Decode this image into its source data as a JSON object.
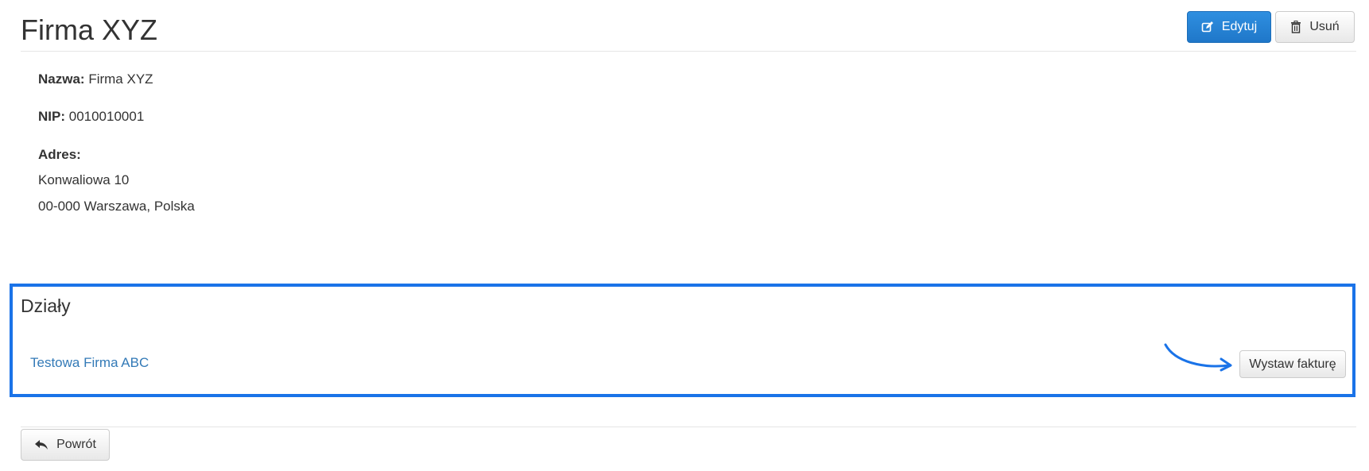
{
  "header": {
    "title": "Firma XYZ",
    "edit_label": "Edytuj",
    "delete_label": "Usuń"
  },
  "details": {
    "name_label": "Nazwa:",
    "name_value": "Firma XYZ",
    "nip_label": "NIP:",
    "nip_value": "0010010001",
    "address_label": "Adres:",
    "address_line1": "Konwaliowa 10",
    "address_line2": "00-000 Warszawa, Polska"
  },
  "departments": {
    "title": "Działy",
    "items": [
      {
        "name": "Testowa Firma ABC",
        "action_label": "Wystaw fakturę"
      }
    ]
  },
  "footer": {
    "back_label": "Powrót"
  },
  "colors": {
    "primary": "#1f77c9",
    "link": "#337ab7",
    "highlight": "#1a73e8"
  },
  "icons": {
    "edit": "edit-icon",
    "delete": "trash-icon",
    "back": "reply-arrow-icon",
    "annotation": "curved-arrow-icon"
  }
}
